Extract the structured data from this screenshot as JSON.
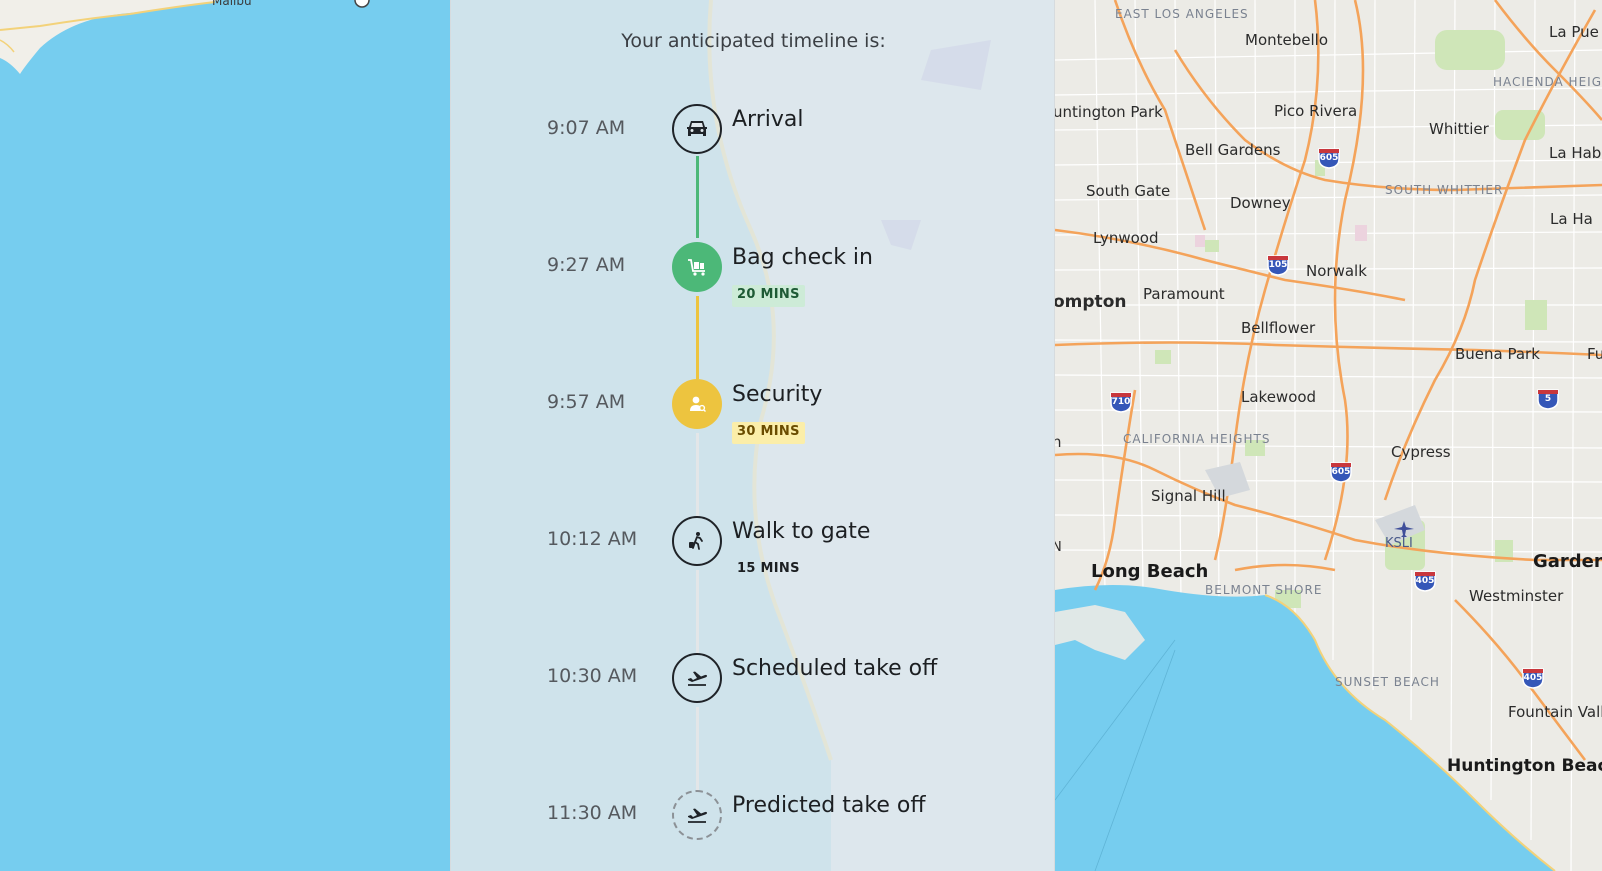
{
  "timeline": {
    "title": "Your anticipated timeline is:",
    "steps": [
      {
        "time": "9:07 AM",
        "label": "Arrival",
        "badge": "",
        "icon": "car-icon",
        "style": "outline"
      },
      {
        "time": "9:27 AM",
        "label": "Bag check in",
        "badge": "20 MINS",
        "icon": "luggage-cart-icon",
        "style": "green"
      },
      {
        "time": "9:57 AM",
        "label": "Security",
        "badge": "30 MINS",
        "icon": "security-screening-icon",
        "style": "yellow"
      },
      {
        "time": "10:12 AM",
        "label": "Walk to gate",
        "badge": "15 MINS",
        "icon": "walking-traveler-icon",
        "style": "outline"
      },
      {
        "time": "10:30 AM",
        "label": "Scheduled take off",
        "badge": "",
        "icon": "plane-departure-icon",
        "style": "outline"
      },
      {
        "time": "11:30 AM",
        "label": "Predicted take off",
        "badge": "",
        "icon": "plane-departure-icon",
        "style": "dashed"
      }
    ],
    "colors": {
      "completed": "#4cb878",
      "security": "#edc43f",
      "pending": "#e3e6e8",
      "text": "#1c1f22"
    }
  },
  "map": {
    "coast_label": "Malibu",
    "cities": [
      {
        "name": "EAST LOS ANGELES",
        "kind": "area"
      },
      {
        "name": "Montebello",
        "kind": "city"
      },
      {
        "name": "La Pue",
        "kind": "city"
      },
      {
        "name": "HACIENDA HEIGHTS",
        "kind": "area"
      },
      {
        "name": "untington Park",
        "kind": "city"
      },
      {
        "name": "Pico Rivera",
        "kind": "city"
      },
      {
        "name": "Whittier",
        "kind": "city"
      },
      {
        "name": "La Hab Heigh",
        "kind": "city"
      },
      {
        "name": "Bell Gardens",
        "kind": "city"
      },
      {
        "name": "South Gate",
        "kind": "city"
      },
      {
        "name": "Downey",
        "kind": "city"
      },
      {
        "name": "SOUTH WHITTIER",
        "kind": "area"
      },
      {
        "name": "La Ha",
        "kind": "city"
      },
      {
        "name": "Lynwood",
        "kind": "city"
      },
      {
        "name": "Norwalk",
        "kind": "city"
      },
      {
        "name": "ompton",
        "kind": "city"
      },
      {
        "name": "Paramount",
        "kind": "city"
      },
      {
        "name": "Bellflower",
        "kind": "city"
      },
      {
        "name": "Buena Park",
        "kind": "city"
      },
      {
        "name": "Fu",
        "kind": "city"
      },
      {
        "name": "Lakewood",
        "kind": "city"
      },
      {
        "name": "CALIFORNIA HEIGHTS",
        "kind": "area"
      },
      {
        "name": "Cypress",
        "kind": "city"
      },
      {
        "name": "Signal Hill",
        "kind": "city"
      },
      {
        "name": "KSLI",
        "kind": "airport"
      },
      {
        "name": "Long Beach",
        "kind": "big"
      },
      {
        "name": "Garden",
        "kind": "big"
      },
      {
        "name": "BELMONT SHORE",
        "kind": "area"
      },
      {
        "name": "Westminster",
        "kind": "city"
      },
      {
        "name": "SUNSET BEACH",
        "kind": "area"
      },
      {
        "name": "Fountain Vall",
        "kind": "city"
      },
      {
        "name": "Huntington Beach",
        "kind": "big"
      },
      {
        "name": "n",
        "kind": "city"
      },
      {
        "name": "N",
        "kind": "city"
      }
    ],
    "shields": [
      "605",
      "105",
      "710",
      "605",
      "5",
      "605",
      "405",
      "405"
    ]
  }
}
